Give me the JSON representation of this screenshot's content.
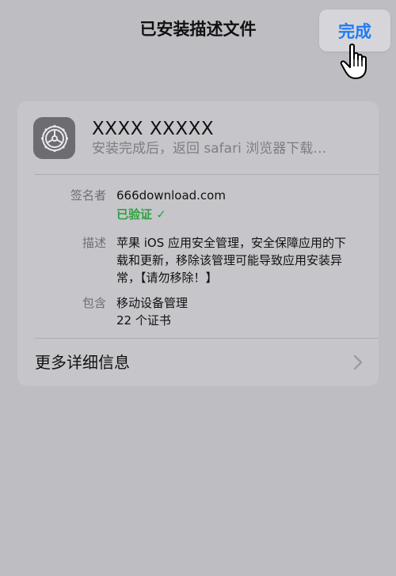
{
  "nav": {
    "title": "已安装描述文件",
    "done_label": "完成"
  },
  "profile": {
    "name": "XXXX XXXXX",
    "subtitle": "安装完成后，返回 safari 浏览器下载…"
  },
  "details": {
    "signer_label": "签名者",
    "signer_value": "666download.com",
    "verified_label": "已验证 ✓",
    "description_label": "描述",
    "description_line1": "苹果 iOS 应用安全管理，安全保障应用的下",
    "description_line2": "载和更新，移除该管理可能导致应用安装异",
    "description_line3": "常，【请勿移除！】",
    "contains_label": "包含",
    "contains_line1": "移动设备管理",
    "contains_line2": "22 个证书"
  },
  "more": {
    "label": "更多详细信息"
  },
  "colors": {
    "background": "#bebdc2",
    "card": "#c6c6ca",
    "accent": "#1f7cf3",
    "verified": "#2fa040",
    "icon_bg": "#6c6c71"
  },
  "icons": {
    "app": "gear-icon",
    "cursor": "hand-pointer-icon",
    "more": "chevron-right-icon"
  }
}
